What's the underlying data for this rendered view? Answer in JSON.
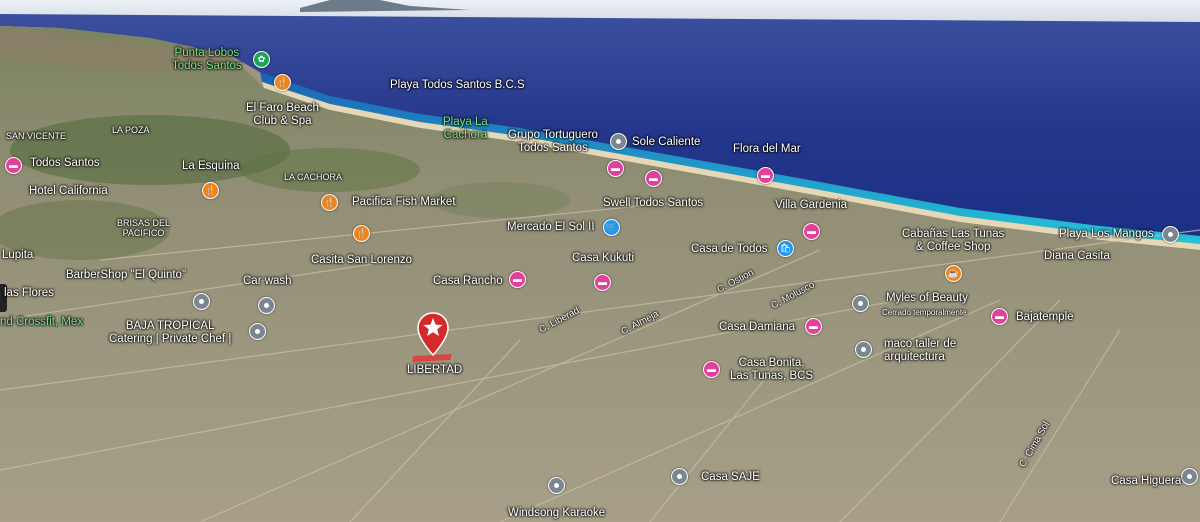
{
  "labels": {
    "punta_lobos": "Punta Lobos\nTodos Santos",
    "playa_todos_santos": "Playa Todos Santos B.C.S",
    "el_faro": "El Faro Beach\nClub & Spa",
    "playa_la_cachora": "Playa La\nCachora",
    "grupo_tortuguero": "Grupo Tortuguero\nTodos Santos",
    "sole_caliente": "Sole Caliente",
    "flora_del_mar": "Flora del Mar",
    "san_vicente": "SAN VICENTE",
    "la_poza": "LA POZA",
    "todos_santos": "Todos Santos",
    "la_esquina": "La Esquina",
    "la_cachora": "LA CACHORA",
    "hotel_california": "Hotel California",
    "pacifica_fish_market": "Pacifica Fish Market",
    "swell_todos_santos": "Swell Todos Santos",
    "villa_gardenia": "Villa Gardenia",
    "brisas_del_pacifico": "BRISAS DEL\nPACIFICO",
    "mercado_el_sol": "Mercado El Sol II",
    "cabanas_las_tunas": "Cabañas Las Tunas\n& Coffee Shop",
    "playa_los_mangos": "Playa Los Mangos",
    "casita_san_lorenzo": "Casita San Lorenzo",
    "casa_de_todos": "Casa de Todos",
    "lupita": "Lupita",
    "diana_casita": "Diana Casita",
    "casa_kukuti": "Casa Kukuti",
    "barbershop": "BarberShop \"El Quinto\"",
    "c_oston": "C. Ostion",
    "car_wash": "Car wash",
    "casa_rancho": "Casa Rancho",
    "c_molusco": "C. Molusco",
    "las_flores": "las Flores",
    "myles_of_beauty": "Myles of Beauty",
    "cerrado_temporalmente": "Cerrado temporalmente",
    "c_liberad": "C. Liberad",
    "c_almeja": "C. Almeja",
    "bajatemple": "Bajatemple",
    "crossfit": "nd Crossfit, Mex",
    "baja_tropical": "BAJA TROPICAL\nCatering | Private Chef |",
    "casa_damiana": "Casa Damiana",
    "maco_taller": "maco taller de\narquitectura",
    "casa_bonita": "Casa Bonita,\nLas Tunas, BCS",
    "libertad": "LIBERTAD",
    "c_cima_sol": "C. Cima Sol",
    "casa_saje": "Casa SAJE",
    "casa_higuera": "Casa Higuera",
    "windsong_karaoke": "Windsong Karaoke"
  },
  "colors": {
    "sky": "#dfe7ef",
    "ocean_deep": "#263d94",
    "ocean_shallow": "#1fb6d4",
    "land": "#a49d85",
    "hotel_pin": "#e0429b",
    "food_pin": "#f0841c",
    "poi_pin": "#7a8790",
    "shop_pin": "#2196f3",
    "park_pin": "#20a35a",
    "marker": "#d42a2a"
  }
}
